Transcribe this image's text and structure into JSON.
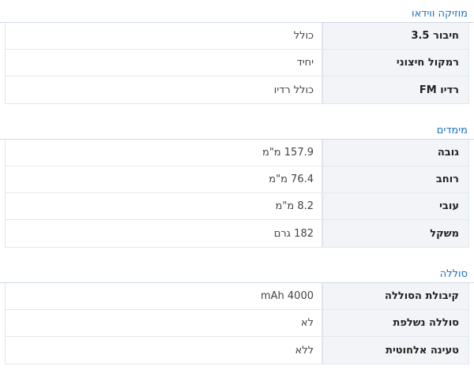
{
  "sections": [
    {
      "title": "מוזיקה ווידאו",
      "rows": [
        {
          "label": "חיבור 3.5",
          "value": "כולל"
        },
        {
          "label": "רמקול חיצוני",
          "value": "יחיד"
        },
        {
          "label": "רדיו FM",
          "value": "כולל רדיו"
        }
      ]
    },
    {
      "title": "מימדים",
      "rows": [
        {
          "label": "גובה",
          "value": "157.9 מ\"מ"
        },
        {
          "label": "רוחב",
          "value": "76.4 מ\"מ"
        },
        {
          "label": "עובי",
          "value": "8.2 מ\"מ"
        },
        {
          "label": "משקל",
          "value": "182 גרם"
        }
      ]
    },
    {
      "title": "סוללה",
      "rows": [
        {
          "label": "קיבולת הסוללה",
          "value": "4000 mAh"
        },
        {
          "label": "סוללה נשלפת",
          "value": "לא"
        },
        {
          "label": "טעינה אלחוטית",
          "value": "ללא"
        }
      ]
    }
  ]
}
